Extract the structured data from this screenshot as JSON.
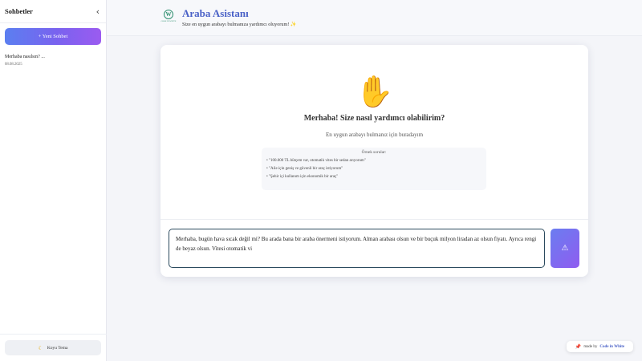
{
  "sidebar": {
    "title": "Sohbetler",
    "collapse_icon": "chevron-left-icon",
    "new_chat_label": "+ Yeni Sohbet",
    "chats": [
      {
        "title": "Merhaba nasılsın? ...",
        "date": "08.08.2025"
      }
    ],
    "theme_button_label": "Koyu Tema",
    "theme_icon": "moon-icon"
  },
  "header": {
    "logo_letter": "W",
    "logo_subtext": "CODE IN WHITE",
    "title": "Araba Asistanı",
    "subtitle": "Size en uygun arabayı bulmanıza yardımcı oluyorum! ✨"
  },
  "welcome": {
    "icon": "waving-hand-icon",
    "title": "Merhaba! Size nasıl yardımcı olabilirim?",
    "subtitle": "En uygun arabayı bulmanız için buradayım",
    "examples_title": "Örnek sorular:",
    "examples": [
      "\"100.000 TL bütçem var, otomatik vites bir sedan arıyorum\"",
      "\"Aile için geniş ve güvenli bir araç istiyorum\"",
      "\"Şehir içi kullanım için ekonomik bir araç\""
    ]
  },
  "input": {
    "value": "Merhaba, bugün hava sıcak değil mi? Bu arada bana bir araba önermeni istiyorum. Alman arabası olsun ve bir buçuk milyon liradan az olsun fiyatı. Ayrıca rengi de beyaz olsun. Vitesi otomatik vi",
    "send_icon": "send-icon"
  },
  "footer": {
    "made_by_prefix": "made by",
    "made_by_brand": "Code in White"
  },
  "colors": {
    "accent": "#4a61c7",
    "gradient_start": "#5b7ff0",
    "gradient_end": "#9b5bf0"
  }
}
